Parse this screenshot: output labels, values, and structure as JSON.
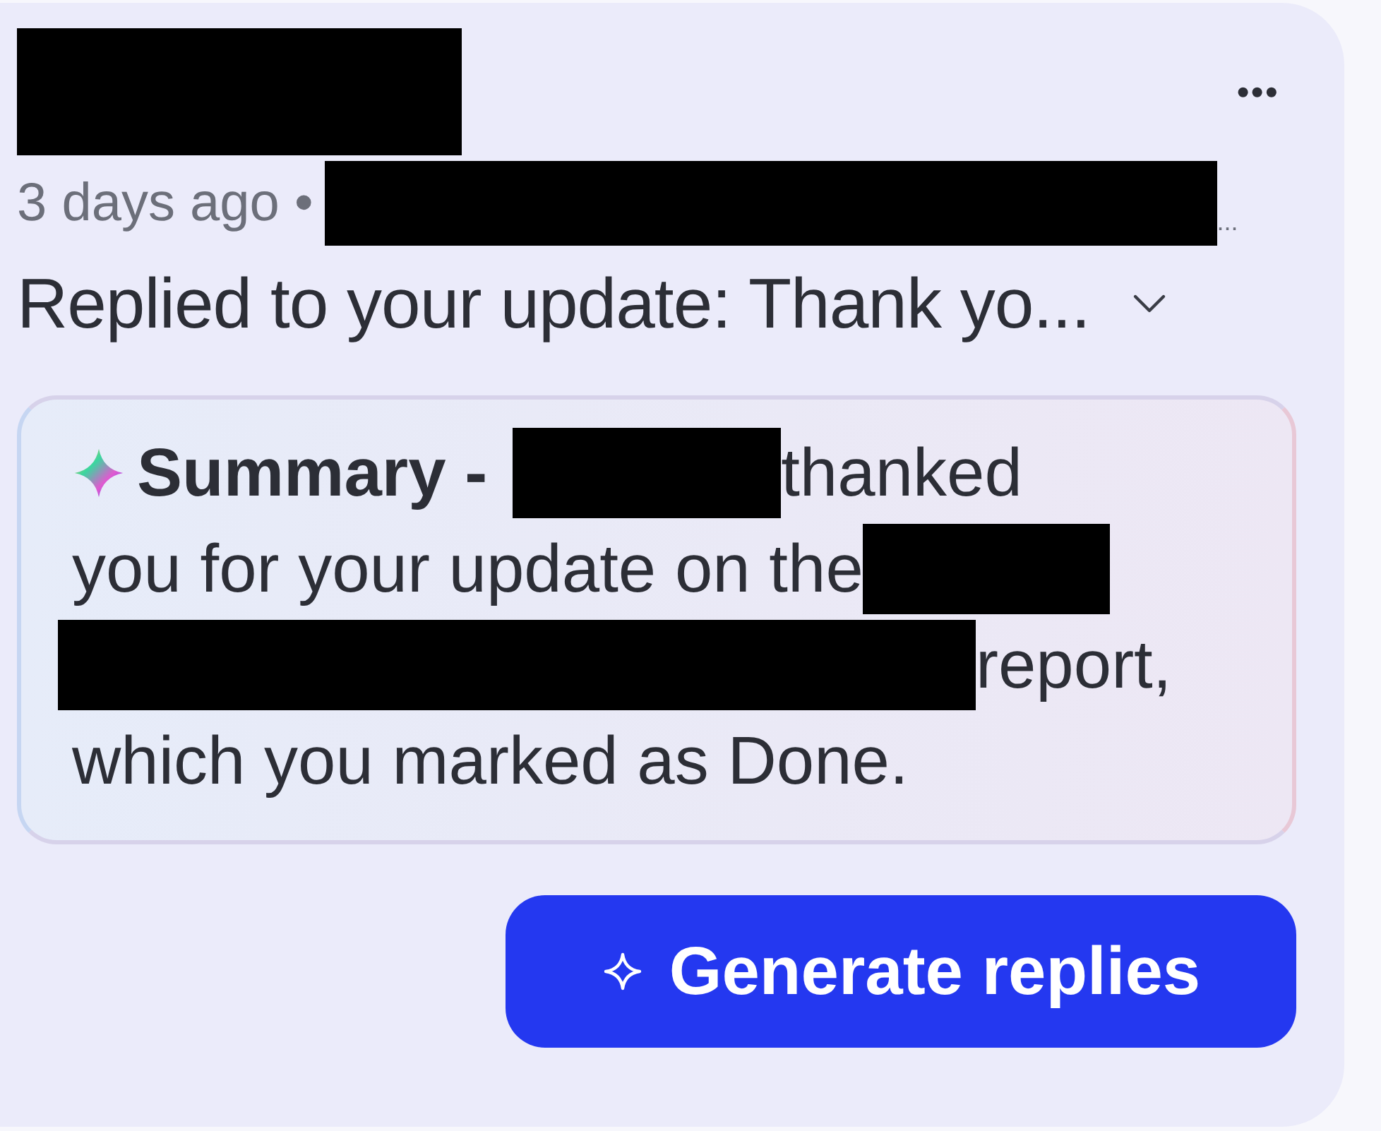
{
  "header": {
    "name": {
      "kind": "redacted"
    },
    "menu": "•••"
  },
  "meta": {
    "time": "3 days ago",
    "separator": "•",
    "detail": {
      "kind": "redacted"
    },
    "overflow": "..."
  },
  "preview": {
    "text": "Replied to your update: Thank yo...",
    "expanded": false
  },
  "summary": {
    "label": "Summary -",
    "lines": [
      [
        {
          "kind": "redacted"
        },
        {
          "kind": "text",
          "text": "thanked"
        }
      ],
      [
        {
          "kind": "text",
          "text": "you for your update on the"
        },
        {
          "kind": "redacted"
        }
      ],
      [
        {
          "kind": "redacted"
        },
        {
          "kind": "text",
          "text": "report,"
        }
      ],
      [
        {
          "kind": "text",
          "text": "which you marked as Done."
        }
      ]
    ]
  },
  "action": {
    "label": "Generate replies"
  }
}
